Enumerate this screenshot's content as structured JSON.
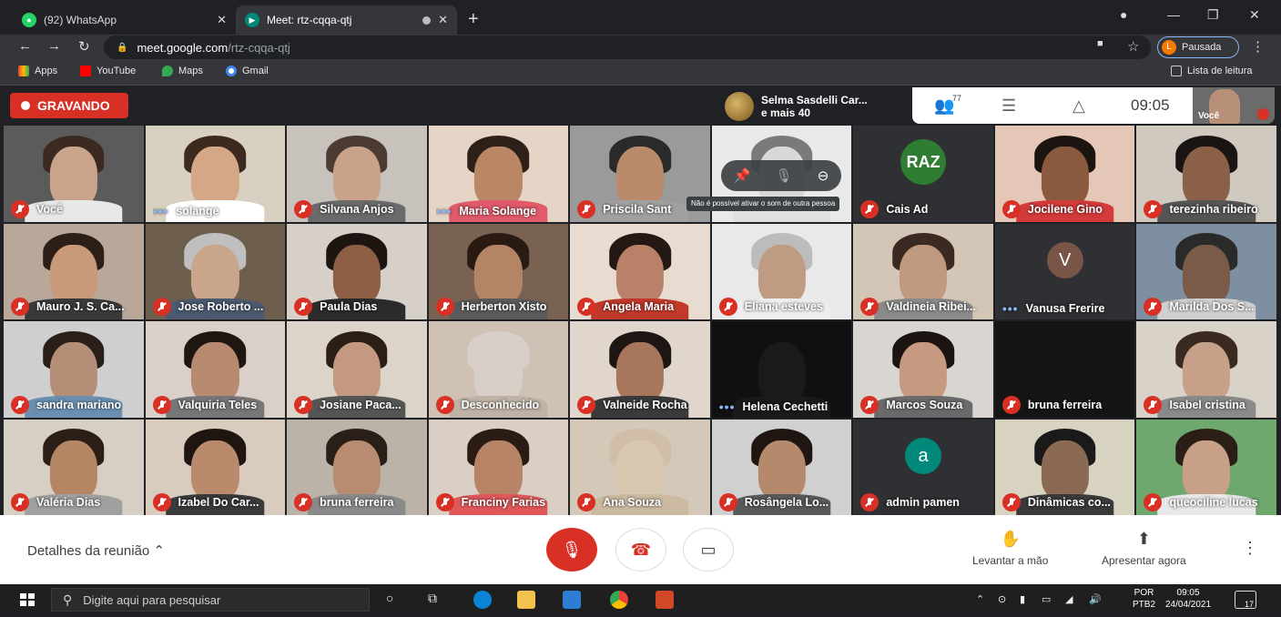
{
  "browser": {
    "tabs": [
      {
        "title": "(92) WhatsApp",
        "badge": "92",
        "active": false
      },
      {
        "title": "Meet: rtz-cqqa-qtj",
        "active": true
      }
    ],
    "url_host": "meet.google.com",
    "url_path": "/rtz-cqqa-qtj",
    "profile_initial": "L",
    "profile_label": "Pausada",
    "bookmarks": [
      "Apps",
      "YouTube",
      "Maps",
      "Gmail"
    ],
    "reading_list": "Lista de leitura"
  },
  "meet": {
    "recording_label": "GRAVANDO",
    "presenter_line1": "Selma Sasdelli Car...",
    "presenter_line2": "e mais 40",
    "participant_count": "77",
    "time": "09:05",
    "self_label": "Você",
    "tooltip": "Não é possível ativar o som de outra pessoa",
    "details_label": "Detalhes da reunião",
    "raise_hand": "Levantar a mão",
    "present_now": "Apresentar agora"
  },
  "participants": [
    {
      "name": "Você",
      "muted": true
    },
    {
      "name": "solange",
      "muted": false
    },
    {
      "name": "Silvana Anjos",
      "muted": true
    },
    {
      "name": "Maria Solange",
      "muted": false
    },
    {
      "name": "Priscila Sant",
      "muted": true
    },
    {
      "name": "",
      "muted": false
    },
    {
      "name": "Cais Ad",
      "muted": true,
      "logo": "RAZ"
    },
    {
      "name": "Jocilene Gino",
      "muted": true
    },
    {
      "name": "terezinha ribeiro",
      "muted": true
    },
    {
      "name": "Mauro J. S. Ca...",
      "muted": true
    },
    {
      "name": "Jose Roberto ...",
      "muted": true
    },
    {
      "name": "Paula Dias",
      "muted": true
    },
    {
      "name": "Herberton Xisto",
      "muted": true
    },
    {
      "name": "Angela Maria",
      "muted": true
    },
    {
      "name": "Eliana esteves",
      "muted": true
    },
    {
      "name": "Valdineia Ribei...",
      "muted": true
    },
    {
      "name": "Vanusa Frerire",
      "muted": false,
      "avatar": "V"
    },
    {
      "name": "Marilda Dos S...",
      "muted": true
    },
    {
      "name": "sandra mariano",
      "muted": true
    },
    {
      "name": "Valquiria Teles",
      "muted": true
    },
    {
      "name": "Josiane Paca...",
      "muted": true
    },
    {
      "name": "Desconhecido",
      "muted": true
    },
    {
      "name": "Valneide Rocha",
      "muted": true
    },
    {
      "name": "Helena Cechetti",
      "muted": false
    },
    {
      "name": "Marcos Souza",
      "muted": true
    },
    {
      "name": "bruna ferreira",
      "muted": true
    },
    {
      "name": "Isabel cristina",
      "muted": true
    },
    {
      "name": "Valéria Dias",
      "muted": true
    },
    {
      "name": "Izabel Do Car...",
      "muted": true
    },
    {
      "name": "bruna ferreira",
      "muted": true
    },
    {
      "name": "Franciny Farias",
      "muted": true
    },
    {
      "name": "Ana Souza",
      "muted": true
    },
    {
      "name": "Rosângela Lo...",
      "muted": true
    },
    {
      "name": "admin pamen",
      "muted": true,
      "avatar": "a"
    },
    {
      "name": "Dinâmicas co...",
      "muted": true
    },
    {
      "name": "queociline lucas",
      "muted": true
    }
  ],
  "taskbar": {
    "search_placeholder": "Digite aqui para pesquisar",
    "lang1": "POR",
    "lang2": "PTB2",
    "clock_time": "09:05",
    "clock_date": "24/04/2021",
    "notifications": "17"
  }
}
